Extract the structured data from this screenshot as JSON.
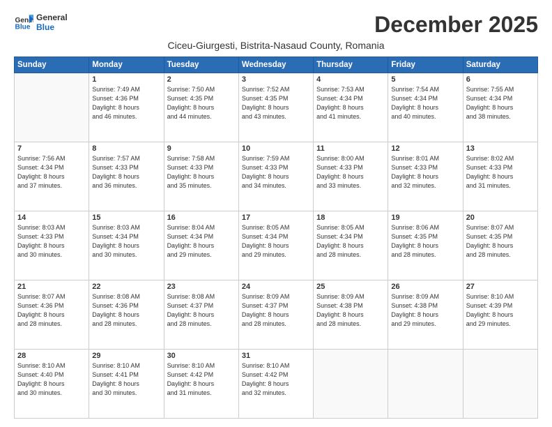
{
  "logo": {
    "line1": "General",
    "line2": "Blue"
  },
  "title": "December 2025",
  "subtitle": "Ciceu-Giurgesti, Bistrita-Nasaud County, Romania",
  "headers": [
    "Sunday",
    "Monday",
    "Tuesday",
    "Wednesday",
    "Thursday",
    "Friday",
    "Saturday"
  ],
  "weeks": [
    [
      {
        "day": "",
        "info": ""
      },
      {
        "day": "1",
        "info": "Sunrise: 7:49 AM\nSunset: 4:36 PM\nDaylight: 8 hours\nand 46 minutes."
      },
      {
        "day": "2",
        "info": "Sunrise: 7:50 AM\nSunset: 4:35 PM\nDaylight: 8 hours\nand 44 minutes."
      },
      {
        "day": "3",
        "info": "Sunrise: 7:52 AM\nSunset: 4:35 PM\nDaylight: 8 hours\nand 43 minutes."
      },
      {
        "day": "4",
        "info": "Sunrise: 7:53 AM\nSunset: 4:34 PM\nDaylight: 8 hours\nand 41 minutes."
      },
      {
        "day": "5",
        "info": "Sunrise: 7:54 AM\nSunset: 4:34 PM\nDaylight: 8 hours\nand 40 minutes."
      },
      {
        "day": "6",
        "info": "Sunrise: 7:55 AM\nSunset: 4:34 PM\nDaylight: 8 hours\nand 38 minutes."
      }
    ],
    [
      {
        "day": "7",
        "info": "Sunrise: 7:56 AM\nSunset: 4:34 PM\nDaylight: 8 hours\nand 37 minutes."
      },
      {
        "day": "8",
        "info": "Sunrise: 7:57 AM\nSunset: 4:33 PM\nDaylight: 8 hours\nand 36 minutes."
      },
      {
        "day": "9",
        "info": "Sunrise: 7:58 AM\nSunset: 4:33 PM\nDaylight: 8 hours\nand 35 minutes."
      },
      {
        "day": "10",
        "info": "Sunrise: 7:59 AM\nSunset: 4:33 PM\nDaylight: 8 hours\nand 34 minutes."
      },
      {
        "day": "11",
        "info": "Sunrise: 8:00 AM\nSunset: 4:33 PM\nDaylight: 8 hours\nand 33 minutes."
      },
      {
        "day": "12",
        "info": "Sunrise: 8:01 AM\nSunset: 4:33 PM\nDaylight: 8 hours\nand 32 minutes."
      },
      {
        "day": "13",
        "info": "Sunrise: 8:02 AM\nSunset: 4:33 PM\nDaylight: 8 hours\nand 31 minutes."
      }
    ],
    [
      {
        "day": "14",
        "info": "Sunrise: 8:03 AM\nSunset: 4:33 PM\nDaylight: 8 hours\nand 30 minutes."
      },
      {
        "day": "15",
        "info": "Sunrise: 8:03 AM\nSunset: 4:34 PM\nDaylight: 8 hours\nand 30 minutes."
      },
      {
        "day": "16",
        "info": "Sunrise: 8:04 AM\nSunset: 4:34 PM\nDaylight: 8 hours\nand 29 minutes."
      },
      {
        "day": "17",
        "info": "Sunrise: 8:05 AM\nSunset: 4:34 PM\nDaylight: 8 hours\nand 29 minutes."
      },
      {
        "day": "18",
        "info": "Sunrise: 8:05 AM\nSunset: 4:34 PM\nDaylight: 8 hours\nand 28 minutes."
      },
      {
        "day": "19",
        "info": "Sunrise: 8:06 AM\nSunset: 4:35 PM\nDaylight: 8 hours\nand 28 minutes."
      },
      {
        "day": "20",
        "info": "Sunrise: 8:07 AM\nSunset: 4:35 PM\nDaylight: 8 hours\nand 28 minutes."
      }
    ],
    [
      {
        "day": "21",
        "info": "Sunrise: 8:07 AM\nSunset: 4:36 PM\nDaylight: 8 hours\nand 28 minutes."
      },
      {
        "day": "22",
        "info": "Sunrise: 8:08 AM\nSunset: 4:36 PM\nDaylight: 8 hours\nand 28 minutes."
      },
      {
        "day": "23",
        "info": "Sunrise: 8:08 AM\nSunset: 4:37 PM\nDaylight: 8 hours\nand 28 minutes."
      },
      {
        "day": "24",
        "info": "Sunrise: 8:09 AM\nSunset: 4:37 PM\nDaylight: 8 hours\nand 28 minutes."
      },
      {
        "day": "25",
        "info": "Sunrise: 8:09 AM\nSunset: 4:38 PM\nDaylight: 8 hours\nand 28 minutes."
      },
      {
        "day": "26",
        "info": "Sunrise: 8:09 AM\nSunset: 4:38 PM\nDaylight: 8 hours\nand 29 minutes."
      },
      {
        "day": "27",
        "info": "Sunrise: 8:10 AM\nSunset: 4:39 PM\nDaylight: 8 hours\nand 29 minutes."
      }
    ],
    [
      {
        "day": "28",
        "info": "Sunrise: 8:10 AM\nSunset: 4:40 PM\nDaylight: 8 hours\nand 30 minutes."
      },
      {
        "day": "29",
        "info": "Sunrise: 8:10 AM\nSunset: 4:41 PM\nDaylight: 8 hours\nand 30 minutes."
      },
      {
        "day": "30",
        "info": "Sunrise: 8:10 AM\nSunset: 4:42 PM\nDaylight: 8 hours\nand 31 minutes."
      },
      {
        "day": "31",
        "info": "Sunrise: 8:10 AM\nSunset: 4:42 PM\nDaylight: 8 hours\nand 32 minutes."
      },
      {
        "day": "",
        "info": ""
      },
      {
        "day": "",
        "info": ""
      },
      {
        "day": "",
        "info": ""
      }
    ]
  ]
}
